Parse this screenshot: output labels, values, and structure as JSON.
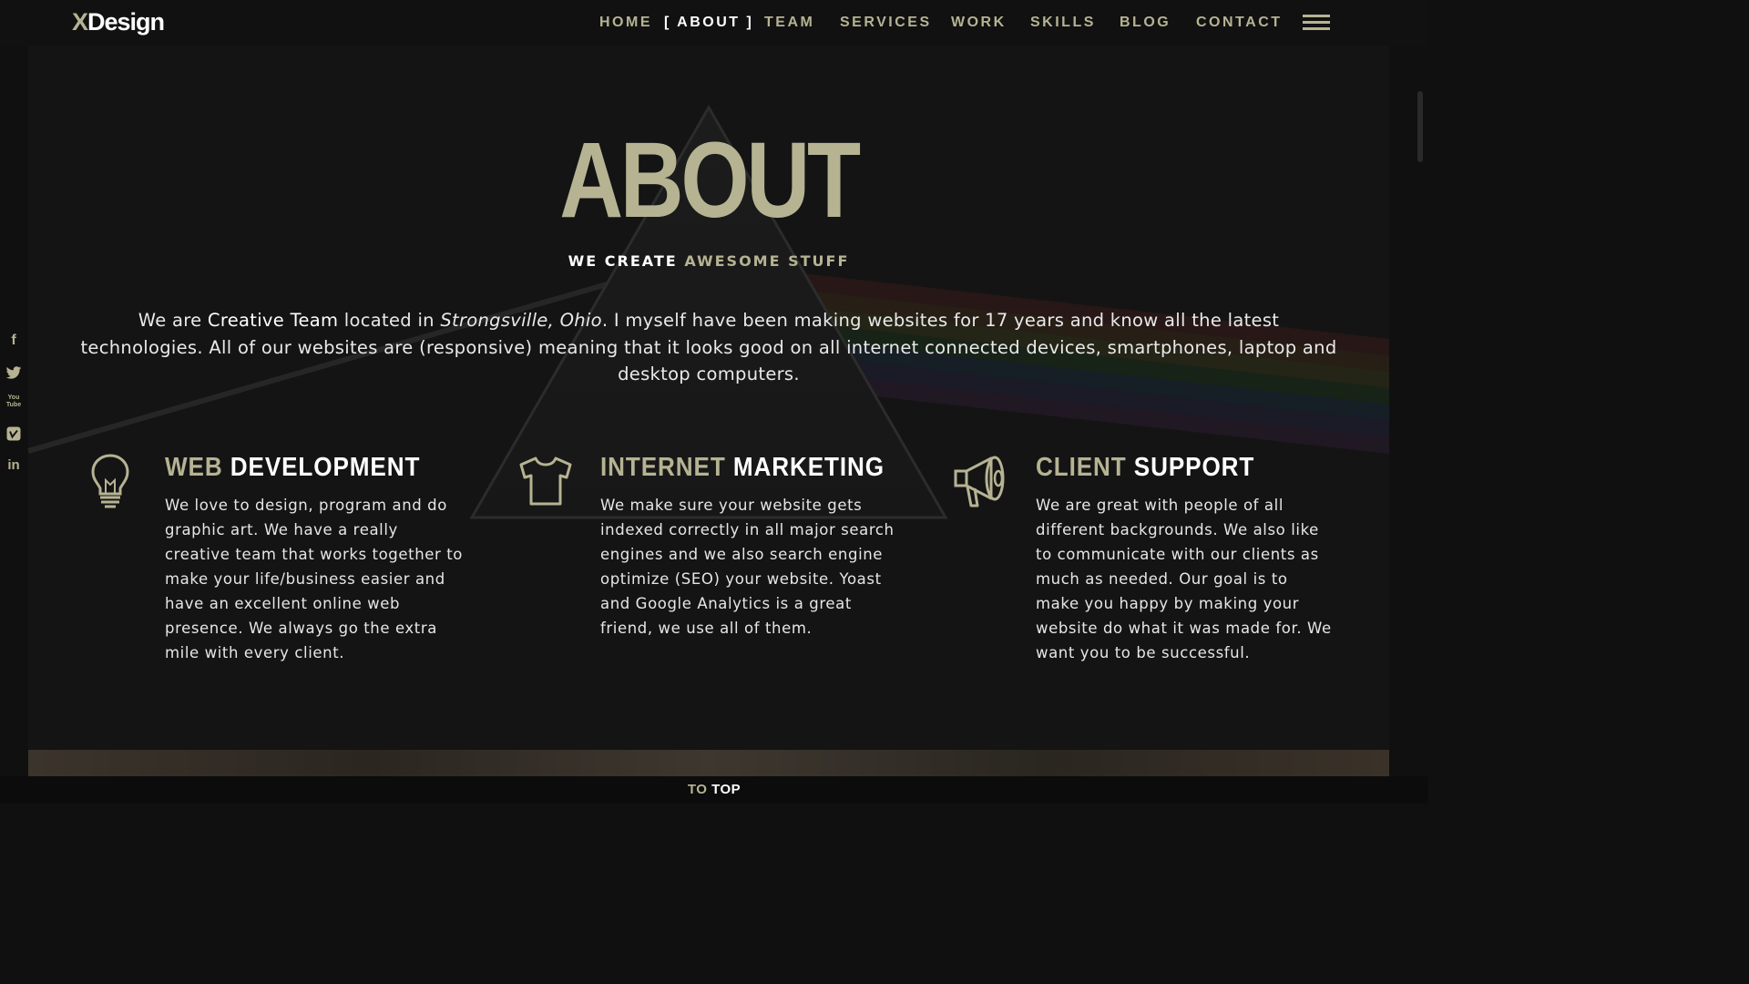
{
  "brand": {
    "logo_accent": "X",
    "logo_rest": "Design"
  },
  "colors": {
    "accent": "#b6b393",
    "background": "#141414",
    "text": "#ffffff"
  },
  "nav": [
    {
      "label": "HOME"
    },
    {
      "label": "[ ABOUT ]",
      "active": true
    },
    {
      "label": "TEAM"
    },
    {
      "label": "SERVICES"
    },
    {
      "label": "WORK"
    },
    {
      "label": "SKILLS"
    },
    {
      "label": "BLOG"
    },
    {
      "label": "CONTACT"
    }
  ],
  "menu_icon": "hamburger-icon",
  "social": [
    {
      "icon": "facebook-icon",
      "glyph": "f"
    },
    {
      "icon": "twitter-icon",
      "glyph": "t"
    },
    {
      "icon": "youtube-icon",
      "glyph": "You Tube"
    },
    {
      "icon": "vimeo-icon",
      "glyph": "V"
    },
    {
      "icon": "linkedin-icon",
      "glyph": "in"
    }
  ],
  "about": {
    "title": "ABOUT",
    "subtitle_white": "WE CREATE",
    "subtitle_accent": "AWESOME STUFF",
    "intro": {
      "part1": "We are ",
      "strong": "Creative Team",
      "part2": " located in ",
      "location": "Strongsville, Ohio",
      "part3": ". I myself have been making websites for 17 years and know all the latest technologies. All of our websites are (responsive) meaning that it looks good on all internet connected devices, smartphones, laptop and desktop computers."
    }
  },
  "features": [
    {
      "icon": "lightbulb-icon",
      "title_accent": "WEB",
      "title_white": "DEVELOPMENT",
      "text": "We love to design, program and do graphic art. We have a really creative team that works together to make your life/business easier and have an excellent online web presence. We always go the extra mile with every client."
    },
    {
      "icon": "tshirt-icon",
      "title_accent": "INTERNET",
      "title_white": "MARKETING",
      "text": "We make sure your website gets indexed correctly in all major search engines and we also search engine optimize (SEO) your website. Yoast and Google Analytics is a great friend, we use all of them."
    },
    {
      "icon": "megaphone-icon",
      "title_accent": "CLIENT",
      "title_white": "SUPPORT",
      "text": "We are great with people of all different backgrounds. We also like to communicate with our clients as much as needed. Our goal is to make you happy by making your website do what it was made for. We want you to be successful."
    }
  ],
  "to_top": {
    "accent": "TO",
    "white": "TOP"
  }
}
